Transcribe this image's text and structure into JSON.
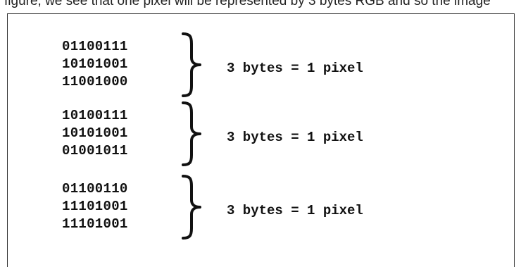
{
  "caption": "figure, we see that one pixel will be represented by 3 bytes RGB and so the image",
  "groups": [
    {
      "bytes": [
        "01100111",
        "10101001",
        "11001000"
      ],
      "label": "3 bytes = 1 pixel"
    },
    {
      "bytes": [
        "10100111",
        "10101001",
        "01001011"
      ],
      "label": "3 bytes = 1 pixel"
    },
    {
      "bytes": [
        "01100110",
        "11101001",
        "11101001"
      ],
      "label": "3 bytes = 1 pixel"
    }
  ]
}
